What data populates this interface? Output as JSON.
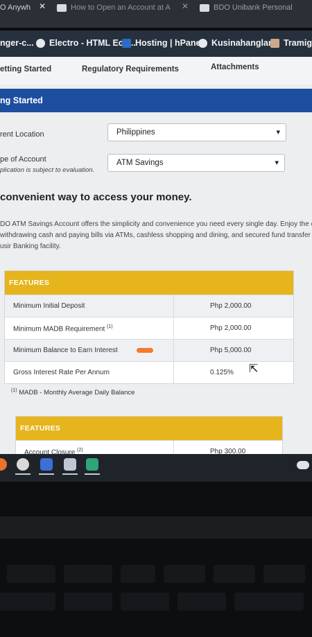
{
  "browser": {
    "tabs": [
      {
        "label": "O Anywh",
        "close": "✕"
      },
      {
        "label": "How to Open an Account at A",
        "close": "✕"
      },
      {
        "label": "BDO Unibank Personal"
      }
    ],
    "bookmarks": [
      {
        "label": "nger-c...",
        "icon": "messenger-icon"
      },
      {
        "label": "Electro - HTML Eco...",
        "icon": "globe-icon"
      },
      {
        "label": "Hosting | hPanel",
        "icon": "hostinger-icon"
      },
      {
        "label": "Kusinahanglan",
        "icon": "globe-icon"
      },
      {
        "label": "Tramigo",
        "icon": "tramigo-icon"
      }
    ]
  },
  "page": {
    "subtabs": [
      "etting Started",
      "Regulatory Requirements",
      "Attachments"
    ],
    "section_title": "ng Started",
    "location": {
      "label": "rent Location",
      "value": "Philippines"
    },
    "account_type": {
      "label": "pe of Account",
      "note": "plication is subject to evaluation.",
      "value": "ATM Savings"
    },
    "heading": "convenient way to access your money.",
    "paragraph": "DO ATM Savings Account offers the simplicity and convenience you need every single day. Enjoy the c withdrawing cash and paying bills via ATMs, cashless shopping and dining, and secured fund transfer usir Banking facility.",
    "features_table": {
      "header": "FEATURES",
      "rows": [
        {
          "label": "Minimum Initial Deposit",
          "sup": "",
          "value": "Php 2,000.00"
        },
        {
          "label": "Minimum MADB Requirement",
          "sup": "(1)",
          "value": "Php 2,000.00"
        },
        {
          "label": "Minimum Balance to Earn Interest",
          "sup": "",
          "value": "Php 5,000.00"
        },
        {
          "label": "Gross Interest Rate Per Annum",
          "sup": "",
          "value": "0.125%"
        }
      ]
    },
    "footnote": {
      "sup": "(1)",
      "text": "MADB - Monthly Average Daily Balance"
    },
    "features_table_2": {
      "header": "FEATURES",
      "rows": [
        {
          "label": "Account Closure",
          "sup": "(2)",
          "value": "Php 300.00"
        }
      ]
    }
  },
  "colors": {
    "brand_blue": "#1e4ea0",
    "features_gold": "#e6b41c",
    "highlight_orange": "#f57a2b"
  }
}
